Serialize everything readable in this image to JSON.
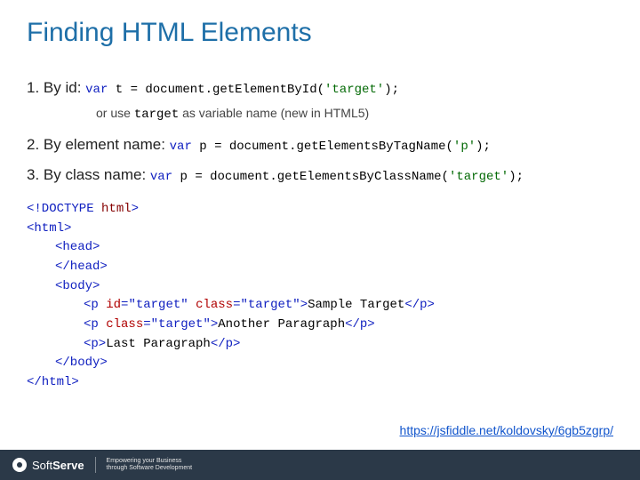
{
  "title": "Finding HTML Elements",
  "items": {
    "byId": {
      "label": "1. By id: ",
      "kw": "var",
      "text1": " t = document.getElementById(",
      "str": "'target'",
      "text2": ");"
    },
    "note": {
      "text1": "or use ",
      "code": "target",
      "text2": " as variable name (new in HTML5)"
    },
    "byTag": {
      "label": "2. By element name: ",
      "kw": "var",
      "text1": " p = document.getElementsByTagName(",
      "str": "'p'",
      "text2": ");"
    },
    "byClass": {
      "label": "3. By class name: ",
      "kw": "var",
      "text1": " p = document.getElementsByClassName(",
      "str": "'target'",
      "text2": ");"
    }
  },
  "code": {
    "l1a": "<!DOCTYPE ",
    "l1b": "html",
    "l1c": ">",
    "l2a": "<html>",
    "l3a": "<head>",
    "l4a": "</head>",
    "l5a": "<body>",
    "l6a": "<p ",
    "l6b": "id",
    "l6c": "=",
    "l6d": "\"target\"",
    "l6e": " ",
    "l6f": "class",
    "l6g": "=",
    "l6h": "\"target\"",
    "l6i": ">",
    "l6t": "Sample Target",
    "l6j": "</p>",
    "l7a": "<p ",
    "l7b": "class",
    "l7c": "=",
    "l7d": "\"target\"",
    "l7e": ">",
    "l7t": "Another Paragraph",
    "l7f": "</p>",
    "l8a": "<p>",
    "l8t": "Last Paragraph",
    "l8b": "</p>",
    "l9a": "</body>",
    "l10a": "</html>"
  },
  "link": "https://jsfiddle.net/koldovsky/6gb5zgrp/",
  "footer": {
    "brand1": "Soft",
    "brand2": "Serve",
    "tagline1": "Empowering your Business",
    "tagline2": "through Software Development"
  }
}
